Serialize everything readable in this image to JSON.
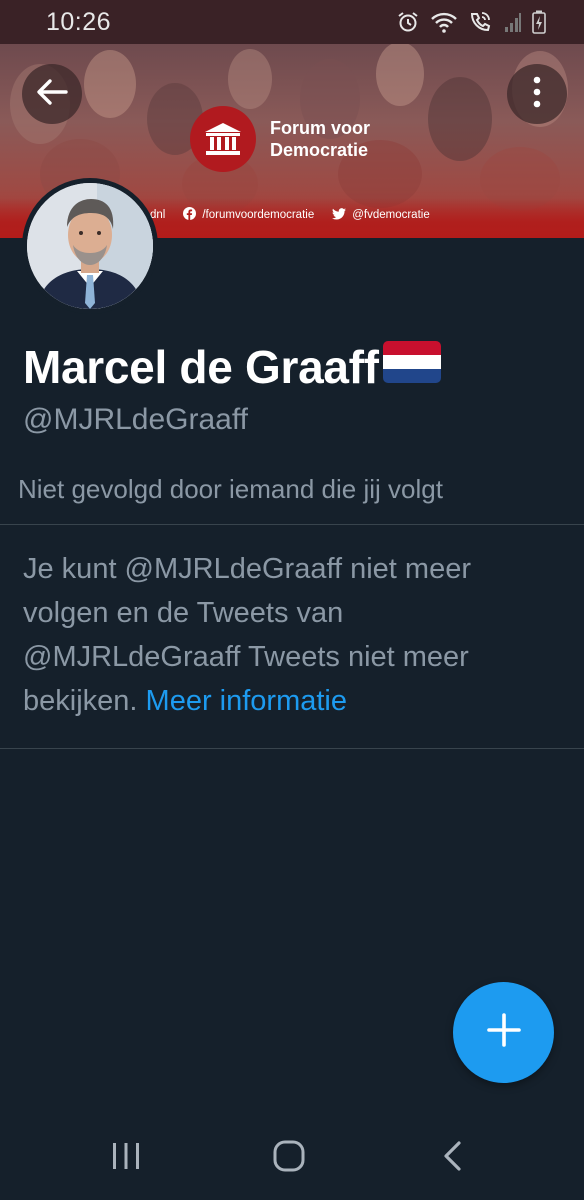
{
  "status_bar": {
    "time": "10:26",
    "icons": [
      "alarm-icon",
      "wifi-icon",
      "wifi-calling-icon",
      "signal-icon",
      "battery-charging-icon"
    ]
  },
  "banner": {
    "org_name_line1": "Forum voor",
    "org_name_line2": "Democratie",
    "social": [
      {
        "icon": "web-icon",
        "label": "dnl"
      },
      {
        "icon": "facebook-icon",
        "label": "/forumvoordemocratie"
      },
      {
        "icon": "twitter-icon",
        "label": "@fvdemocratie"
      }
    ],
    "colors": {
      "brand_red": "#b11a1f"
    }
  },
  "profile": {
    "display_name": "Marcel de Graaff",
    "flag": "netherlands-flag-icon",
    "handle": "@MJRLdeGraaff",
    "follow_context": "Niet gevolgd door iemand die jij volgt"
  },
  "blocked_notice": {
    "text": "Je kunt @MJRLdeGraaff niet meer volgen en de Tweets van @MJRLdeGraaff Tweets niet meer bekijken.",
    "link_label": "Meer informatie"
  },
  "fab": {
    "icon": "plus-icon"
  },
  "nav": {
    "icons": [
      "recents-icon",
      "home-icon",
      "back-icon"
    ]
  },
  "theme": {
    "background": "#15202b",
    "accent": "#1d9bf0",
    "secondary_text": "#8b98a5",
    "divider": "#38444d"
  }
}
